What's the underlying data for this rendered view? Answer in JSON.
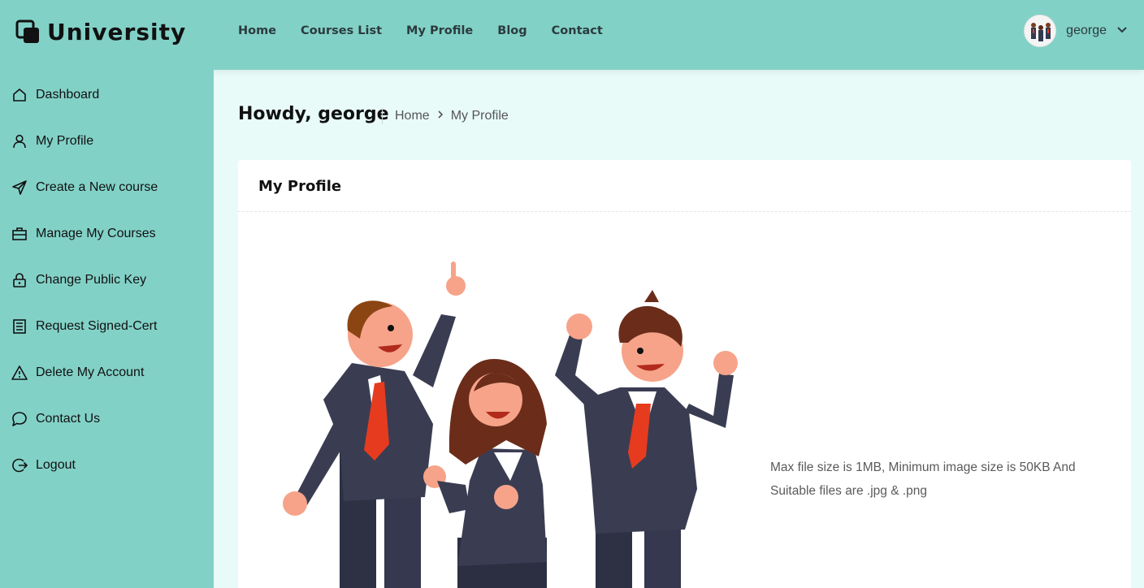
{
  "brand": {
    "name": "University"
  },
  "topnav": {
    "items": [
      {
        "label": "Home"
      },
      {
        "label": "Courses List"
      },
      {
        "label": "My Profile"
      },
      {
        "label": "Blog"
      },
      {
        "label": "Contact"
      }
    ]
  },
  "user": {
    "name": "george"
  },
  "sidebar": {
    "items": [
      {
        "label": "Dashboard",
        "icon": "home-icon"
      },
      {
        "label": "My Profile",
        "icon": "user-icon"
      },
      {
        "label": "Create a New course",
        "icon": "send-icon"
      },
      {
        "label": "Manage My Courses",
        "icon": "briefcase-icon"
      },
      {
        "label": "Change Public Key",
        "icon": "lock-icon"
      },
      {
        "label": "Request Signed-Cert",
        "icon": "document-icon"
      },
      {
        "label": "Delete My Account",
        "icon": "warning-icon"
      },
      {
        "label": "Contact Us",
        "icon": "chat-icon"
      },
      {
        "label": "Logout",
        "icon": "logout-icon"
      }
    ]
  },
  "header": {
    "greeting": "Howdy, george",
    "breadcrumb": {
      "home": "Home",
      "current": "My Profile"
    }
  },
  "profile": {
    "title": "My Profile",
    "upload_hint": "Max file size is 1MB, Minimum image size is 50KB And Suitable files are .jpg & .png"
  },
  "colors": {
    "accent": "#82d1c7",
    "background": "#e8fbf9",
    "suit": "#3a3d52",
    "tie": "#e63b1f"
  }
}
